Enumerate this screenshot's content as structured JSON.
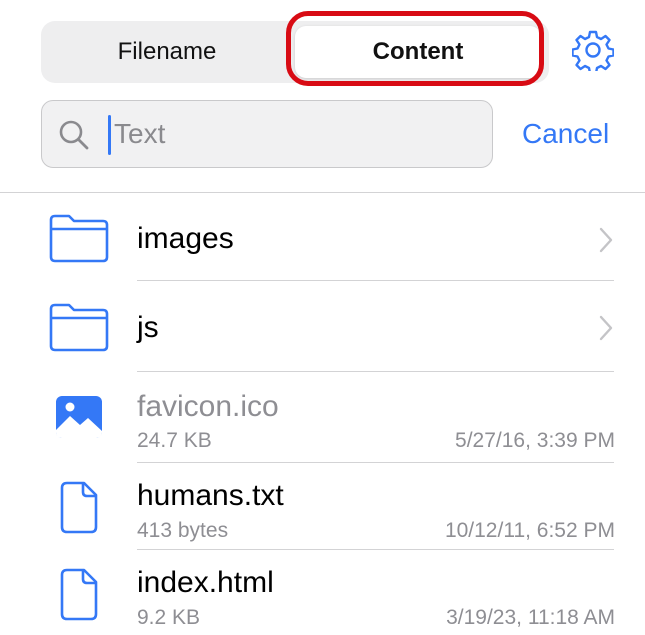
{
  "segmented": {
    "filename_label": "Filename",
    "content_label": "Content",
    "selected": "Content"
  },
  "settings_icon": "gear-icon",
  "search": {
    "placeholder": "Text",
    "value": "",
    "cancel_label": "Cancel"
  },
  "colors": {
    "accent": "#3478f6",
    "highlight": "#d80b14",
    "secondary_text": "#8e8e93"
  },
  "files": [
    {
      "name": "images",
      "type": "folder",
      "icon": "folder-icon"
    },
    {
      "name": "js",
      "type": "folder",
      "icon": "folder-icon"
    },
    {
      "name": "favicon.ico",
      "type": "image",
      "icon": "image-file-icon",
      "size": "24.7 KB",
      "date": "5/27/16, 3:39 PM",
      "dimmed": true
    },
    {
      "name": "humans.txt",
      "type": "document",
      "icon": "document-icon",
      "size": "413 bytes",
      "date": "10/12/11, 6:52 PM"
    },
    {
      "name": "index.html",
      "type": "document",
      "icon": "document-icon",
      "size": "9.2 KB",
      "date": "3/19/23, 11:18 AM"
    }
  ]
}
